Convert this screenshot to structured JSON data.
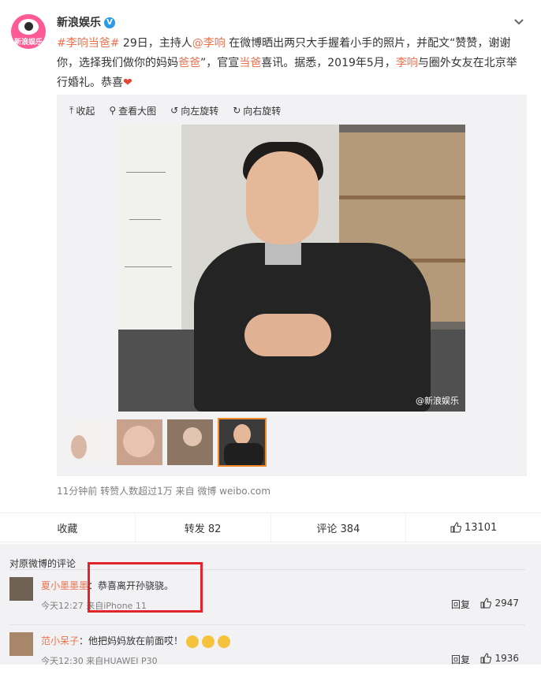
{
  "post": {
    "author": "新浪娱乐",
    "verified_mark": "V",
    "logo_text": "新浪娱乐",
    "text": {
      "tag": "#李响当爸#",
      "part1": " 29日，主持人",
      "mention": "@李响",
      "part2": " 在微博晒出两只大手握着小手的照片，并配文“赞赞，谢谢你，选择我们做你的妈妈",
      "link1": "爸爸",
      "part3": "”，官宣",
      "link2": "当爸",
      "part4": "喜讯。据悉，2019年5月，",
      "link3": "李响",
      "part5": "与圈外女友在北京举行婚礼。恭喜"
    },
    "media_bar": {
      "collapse": "收起",
      "view_large": "查看大图",
      "rotate_left": "向左旋转",
      "rotate_right": "向右旋转"
    },
    "photo_credit": "@新浪娱乐",
    "meta": "11分钟前 转赞人数超过1万 来自 微博 weibo.com"
  },
  "actions": {
    "favorite": "收藏",
    "repost": "转发 82",
    "comment": "评论 384",
    "like": "13101"
  },
  "comments": {
    "title": "对原微博的评论",
    "items": [
      {
        "name": "夏小墨墨墨",
        "text": "：恭喜离开孙骁骁。",
        "time": "今天12:27 来自iPhone 11",
        "reply": "回复",
        "likes": "2947"
      },
      {
        "name": "范小呆子",
        "text": "：他把妈妈放在前面哎！",
        "time": "今天12:30 来自HUAWEI P30",
        "reply": "回复",
        "likes": "1936"
      }
    ]
  },
  "colors": {
    "link": "#eb7350",
    "verified": "#2a9be4",
    "highlight": "#e3242b"
  }
}
